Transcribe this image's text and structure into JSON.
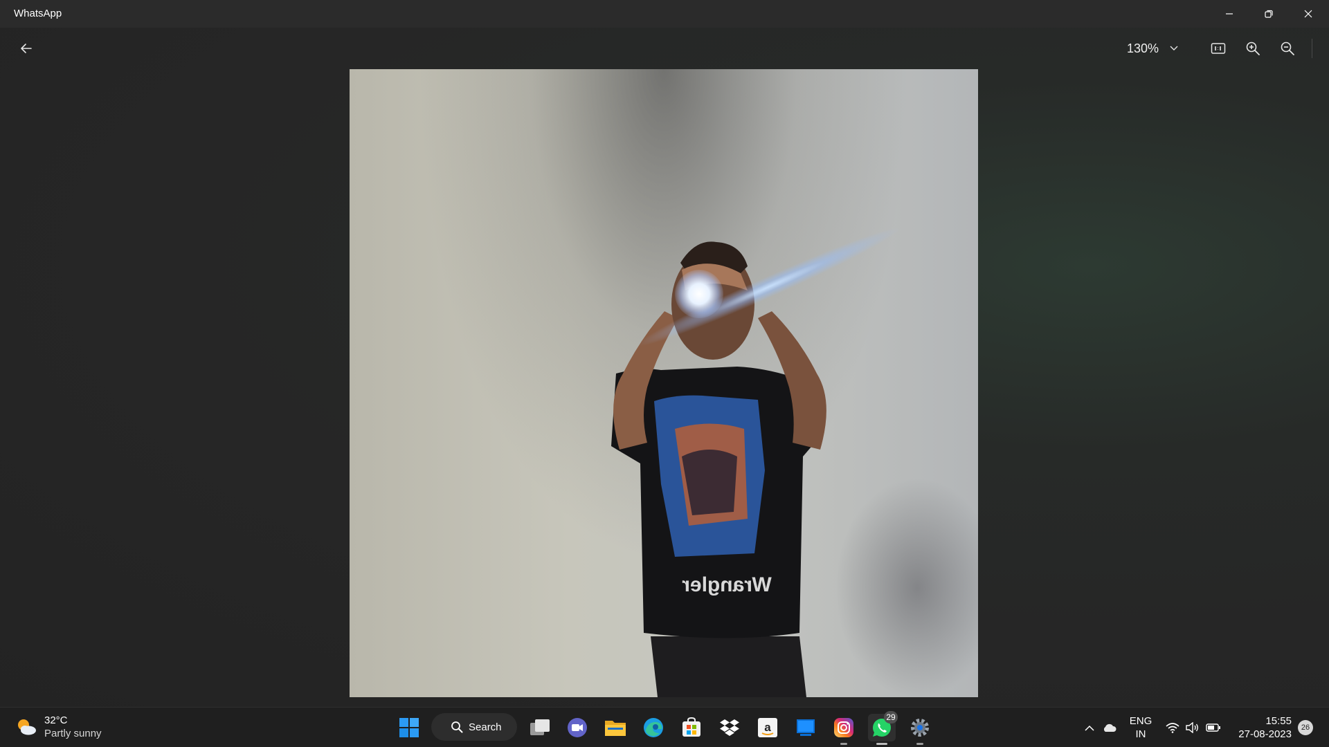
{
  "window": {
    "title": "WhatsApp",
    "minimize_icon": "minimize-icon",
    "restore_icon": "restore-icon",
    "close_icon": "close-icon"
  },
  "viewer": {
    "back_icon": "back-arrow-icon",
    "zoom_level": "130%",
    "zoom_dropdown_icon": "chevron-down-icon",
    "actual_size_icon": "actual-size-icon",
    "zoom_in_icon": "zoom-in-icon",
    "zoom_out_icon": "zoom-out-icon",
    "photo_shirt_text": "Wrangler"
  },
  "taskbar": {
    "weather": {
      "temperature": "32°C",
      "condition": "Partly sunny",
      "icon": "partly-sunny-icon"
    },
    "search_label": "Search",
    "apps": [
      {
        "name": "start",
        "icon": "windows-start-icon"
      },
      {
        "name": "search",
        "icon": "search-icon"
      },
      {
        "name": "task-view",
        "icon": "task-view-icon"
      },
      {
        "name": "teams-chat",
        "icon": "video-chat-icon"
      },
      {
        "name": "file-explorer",
        "icon": "folder-icon"
      },
      {
        "name": "edge",
        "icon": "edge-browser-icon"
      },
      {
        "name": "microsoft-store",
        "icon": "store-icon"
      },
      {
        "name": "dropbox",
        "icon": "dropbox-icon"
      },
      {
        "name": "amazon",
        "icon": "amazon-icon"
      },
      {
        "name": "blue-app",
        "icon": "blue-window-app-icon"
      },
      {
        "name": "instagram",
        "icon": "instagram-icon"
      },
      {
        "name": "whatsapp",
        "icon": "whatsapp-icon",
        "badge": "29"
      },
      {
        "name": "settings",
        "icon": "settings-gear-icon"
      }
    ],
    "tray": {
      "overflow_icon": "chevron-up-icon",
      "cloud_icon": "onedrive-cloud-icon",
      "language_line1": "ENG",
      "language_line2": "IN",
      "wifi_icon": "wifi-icon",
      "volume_icon": "volume-icon",
      "battery_icon": "battery-icon",
      "time": "15:55",
      "date": "27-08-2023",
      "notification_count": "26"
    }
  },
  "colors": {
    "titlebar": "#2b2b2b",
    "viewer_bg": "#262626",
    "taskbar": "#1f1f1f",
    "whatsapp_green": "#25d366",
    "windows_blue": "#0a84ff"
  }
}
